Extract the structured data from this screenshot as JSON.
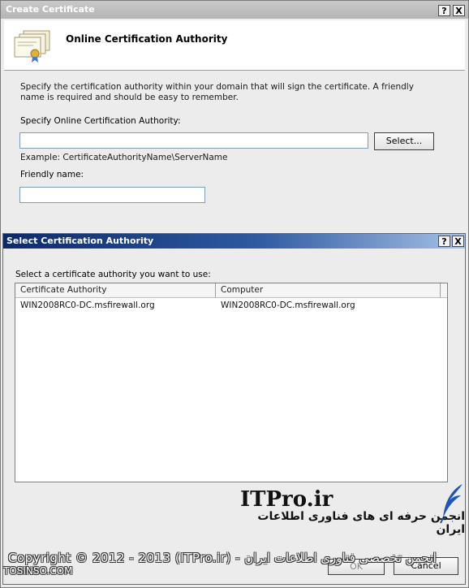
{
  "outer_window": {
    "title": "Create Certificate",
    "help_label": "?",
    "close_label": "X",
    "header_title": "Online Certification Authority",
    "description": "Specify the certification authority within your domain that will sign the certificate. A friendly name is required and should be easy to remember.",
    "ca_label": "Specify Online Certification Authority:",
    "ca_value": "",
    "select_button": "Select...",
    "example": "Example: CertificateAuthorityName\\ServerName",
    "friendly_label": "Friendly name:",
    "friendly_value": ""
  },
  "inner_dialog": {
    "title": "Select Certification Authority",
    "help_label": "?",
    "close_label": "X",
    "prompt": "Select a certificate authority you want to use:",
    "columns": [
      "Certificate Authority",
      "Computer"
    ],
    "rows": [
      [
        "WIN2008RC0-DC.msfirewall.org",
        "WIN2008RC0-DC.msfirewall.org"
      ]
    ],
    "ok_button": "OK",
    "cancel_button": "Cancel"
  },
  "watermark": {
    "brand": "ITPro.ir",
    "subtitle": "انجمن حرفه ای های فناوری اطلاعات ایران",
    "copyright": "Copyright © 2012 - 2013 (ITPro.ir) - انجمن تخصصی فناوری اطلاعات ایران",
    "site": "TOSINSO.COM"
  }
}
